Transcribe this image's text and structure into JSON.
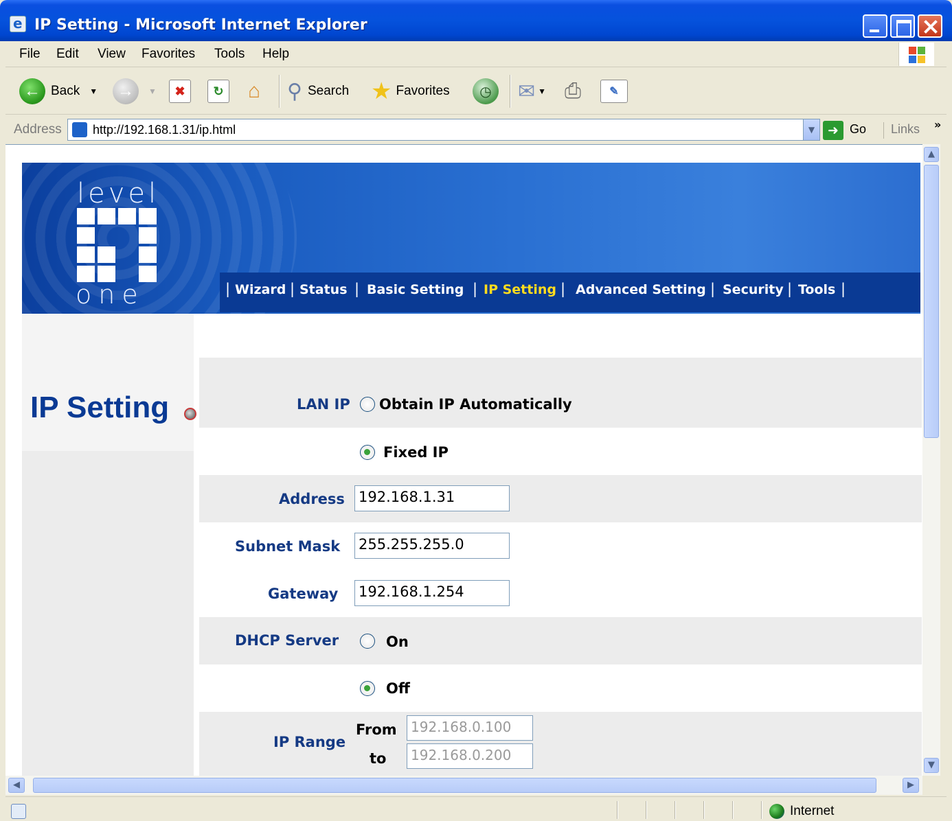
{
  "window": {
    "title": "IP Setting - Microsoft Internet Explorer"
  },
  "menu": [
    "File",
    "Edit",
    "View",
    "Favorites",
    "Tools",
    "Help"
  ],
  "toolbar": {
    "back": "Back",
    "search": "Search",
    "favorites": "Favorites"
  },
  "address": {
    "label": "Address",
    "url": "http://192.168.1.31/ip.html",
    "go": "Go",
    "links": "Links"
  },
  "status": {
    "zone": "Internet"
  },
  "page": {
    "logo_top": "level",
    "logo_bottom": "one",
    "nav": [
      "Wizard",
      "Status",
      "Basic Setting",
      "IP Setting",
      "Advanced Setting",
      "Security",
      "Tools"
    ],
    "nav_active": "IP Setting",
    "title": "IP Setting",
    "form": {
      "lan_ip_label": "LAN IP",
      "lan_auto": "Obtain IP Automatically",
      "lan_fixed": "Fixed IP",
      "lan_mode": "Fixed IP",
      "address_label": "Address",
      "address_value": "192.168.1.31",
      "subnet_label": "Subnet Mask",
      "subnet_value": "255.255.255.0",
      "gateway_label": "Gateway",
      "gateway_value": "192.168.1.254",
      "dhcp_label": "DHCP Server",
      "dhcp_on": "On",
      "dhcp_off": "Off",
      "dhcp_mode": "Off",
      "range_label": "IP Range",
      "range_from_label": "From",
      "range_from_value": "192.168.0.100",
      "range_to_label": "to",
      "range_to_value": "192.168.0.200"
    }
  }
}
